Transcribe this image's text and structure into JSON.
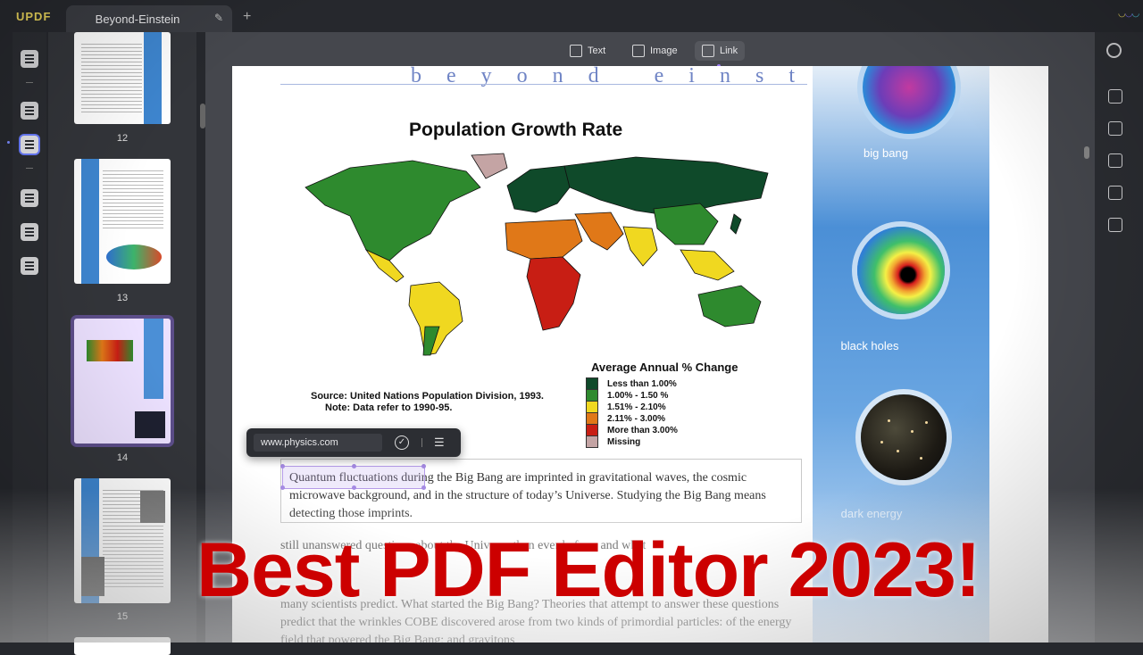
{
  "app": {
    "logo": "UPDF",
    "tab_title": "Beyond-Einstein"
  },
  "toolbar": {
    "text_label": "Text",
    "image_label": "Image",
    "link_label": "Link"
  },
  "thumbnails": [
    {
      "page": "12"
    },
    {
      "page": "13"
    },
    {
      "page": "14",
      "selected": true
    },
    {
      "page": "15"
    }
  ],
  "page": {
    "header": "beyond einstein",
    "map_title": "Population Growth Rate",
    "legend_title": "Average Annual % Change",
    "legend": [
      {
        "label": "Less than 1.00%",
        "color": "#0f4a2a"
      },
      {
        "label": "1.00% - 1.50 %",
        "color": "#2e8a2e"
      },
      {
        "label": "1.51% - 2.10%",
        "color": "#f0d820"
      },
      {
        "label": "2.11% - 3.00%",
        "color": "#e07818"
      },
      {
        "label": "More than 3.00%",
        "color": "#c81e14"
      },
      {
        "label": "Missing",
        "color": "#c4a4a4"
      }
    ],
    "source_line1": "Source: United Nations Population Division, 1993.",
    "source_line2": "Note: Data refer to 1990-95.",
    "link_text": "Quantum fluctuations",
    "para1": "Quantum fluctuations during the Big Bang are imprinted in gravitational waves, the cosmic microwave background, and in the structure of today’s Universe. Studying the Big Bang means detecting those imprints.",
    "para2": "still unanswered questions about the Universe than ever before, and what",
    "para3": "many scientists predict. What started the Big Bang? Theories that attempt to answer these questions predict that the wrinkles COBE discovered arose from two kinds of primordial particles: of the energy field that powered the Big Bang; and gravitons",
    "captions": {
      "big_bang": "big bang",
      "black_holes": "black holes",
      "dark_energy": "dark energy"
    }
  },
  "link_popup": {
    "url": "www.physics.com"
  },
  "headline": "Best PDF Editor 2023!",
  "colors": {
    "accent": "#7b6cf6",
    "headline": "#cc0000",
    "link_highlight": "#b59be8"
  }
}
